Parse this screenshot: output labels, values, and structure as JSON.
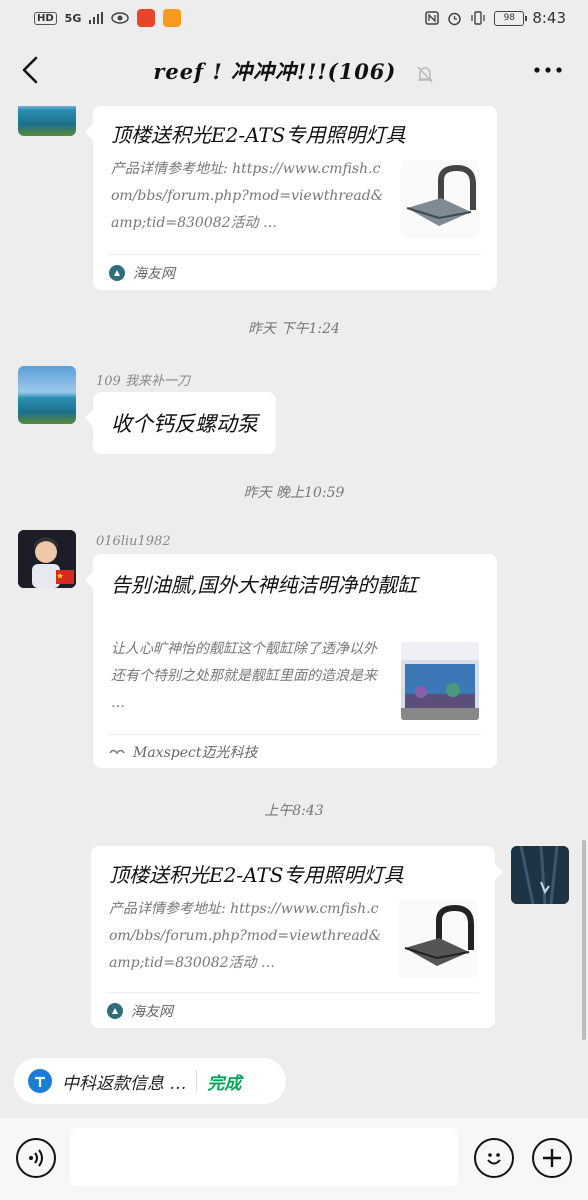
{
  "status_bar": {
    "left_chips": [
      "HD",
      "5G"
    ],
    "time": "8:43",
    "battery": "98"
  },
  "header": {
    "title": "reef ! 冲冲冲!!!(106)",
    "back_icon": "chevron-left-icon",
    "mute_icon": "bell-off-icon",
    "more_icon": "more-dots-icon"
  },
  "messages": [
    {
      "type": "link",
      "side": "left",
      "title": "顶楼送积光E2-ATS专用照明灯具",
      "desc": "产品详情参考地址: https://www.cmfish.com/bbs/forum.php?mod=viewthread&amp;tid=830082活动 …",
      "source": "海友网"
    },
    {
      "type": "time",
      "label": "昨天 下午1:24"
    },
    {
      "type": "text",
      "side": "left",
      "sender": "109 我来补一刀",
      "text": "收个钙反螺动泵"
    },
    {
      "type": "time",
      "label": "昨天 晚上10:59"
    },
    {
      "type": "link",
      "side": "left",
      "sender": "016liu1982",
      "title": "告别油腻,国外大神纯洁明净的靓缸",
      "desc": "让人心旷神怡的靓缸这个靓缸除了透净以外还有个特别之处那就是靓缸里面的造浪是来 …",
      "source": "Maxspect迈光科技"
    },
    {
      "type": "time",
      "label": "上午8:43"
    },
    {
      "type": "link",
      "side": "right",
      "title": "顶楼送积光E2-ATS专用照明灯具",
      "desc": "产品详情参考地址: https://www.cmfish.com/bbs/forum.php?mod=viewthread&amp;tid=830082活动 …",
      "source": "海友网"
    }
  ],
  "quote_chip": {
    "text": "中科返款信息 …",
    "action": "完成"
  },
  "input_bar": {
    "voice_icon": "voice-icon",
    "emoji_icon": "emoji-icon",
    "plus_icon": "plus-icon"
  },
  "colors": {
    "background": "#ededed",
    "bubble": "#ffffff",
    "done_green": "#07a35a"
  }
}
